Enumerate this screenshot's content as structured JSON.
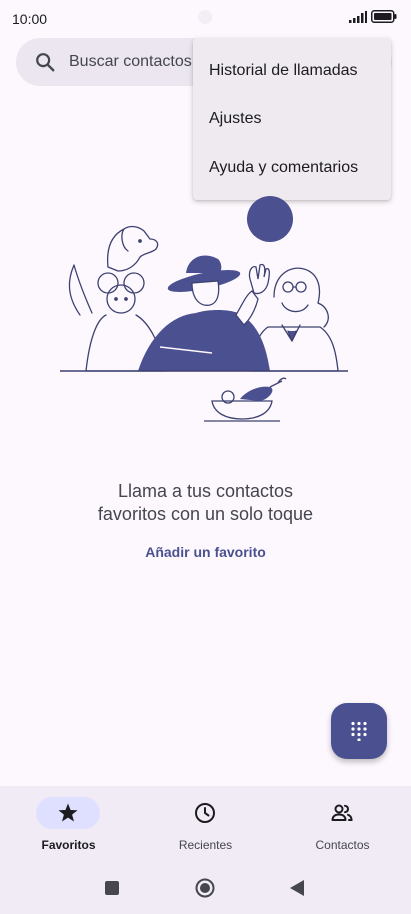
{
  "status_bar": {
    "time": "10:00",
    "signal_icon": "signal-icon",
    "battery_icon": "battery-icon"
  },
  "search": {
    "placeholder": "Buscar contactos",
    "icon": "search-icon"
  },
  "overflow_menu": {
    "items": [
      {
        "label": "Historial de llamadas"
      },
      {
        "label": "Ajustes"
      },
      {
        "label": "Ayuda y comentarios"
      }
    ]
  },
  "empty_state": {
    "message_line1": "Llama a tus contactos",
    "message_line2": "favoritos con un solo toque",
    "action_label": "Añadir un favorito"
  },
  "fab": {
    "icon": "dialpad-icon"
  },
  "bottom_nav": {
    "items": [
      {
        "label": "Favoritos",
        "icon": "star-icon",
        "active": true
      },
      {
        "label": "Recientes",
        "icon": "clock-icon",
        "active": false
      },
      {
        "label": "Contactos",
        "icon": "people-icon",
        "active": false
      }
    ]
  },
  "system_nav": {
    "recents": "square-icon",
    "home": "circle-icon",
    "back": "triangle-icon"
  },
  "colors": {
    "accent": "#4b5190",
    "background": "#fdf8fd",
    "nav_background": "#f0ebf4",
    "active_pill": "#dfe0ff"
  }
}
